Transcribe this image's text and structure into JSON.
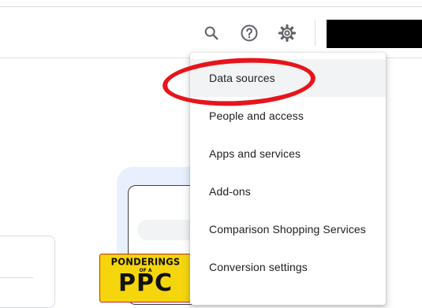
{
  "toolbar": {
    "search_icon": "search-icon",
    "help_icon": "help-circle-icon",
    "settings_icon": "gear-icon"
  },
  "settings_menu": {
    "items": [
      {
        "label": "Data sources"
      },
      {
        "label": "People and access"
      },
      {
        "label": "Apps and services"
      },
      {
        "label": "Add-ons"
      },
      {
        "label": "Comparison Shopping Services"
      },
      {
        "label": "Conversion settings"
      }
    ]
  },
  "illustration": {
    "book_title": "PONDERINGS",
    "book_subtitle": "OF A",
    "book_big": "PPC"
  },
  "colors": {
    "highlight": "#e8141b",
    "book_yellow": "#f5d60c",
    "illustration_blue": "#e8f0fe"
  }
}
